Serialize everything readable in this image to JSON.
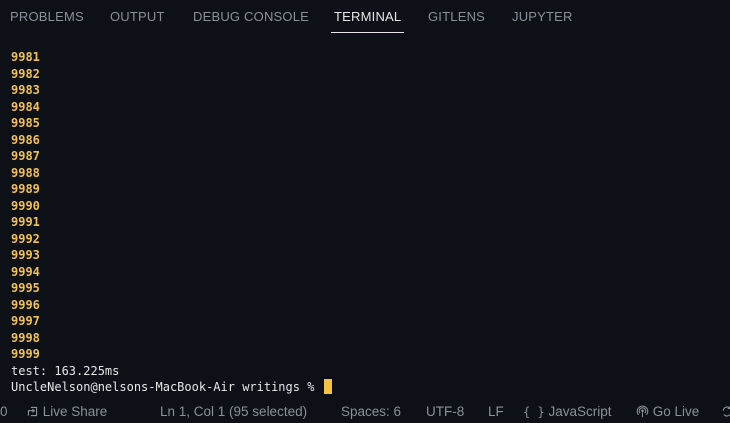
{
  "panel": {
    "tabs": [
      {
        "label": "PROBLEMS"
      },
      {
        "label": "OUTPUT"
      },
      {
        "label": "DEBUG CONSOLE"
      },
      {
        "label": "TERMINAL",
        "active": true
      },
      {
        "label": "GITLENS"
      },
      {
        "label": "JUPYTER"
      }
    ]
  },
  "terminal": {
    "numbers": [
      "9981",
      "9982",
      "9983",
      "9984",
      "9985",
      "9986",
      "9987",
      "9988",
      "9989",
      "9990",
      "9991",
      "9992",
      "9993",
      "9994",
      "9995",
      "9996",
      "9997",
      "9998",
      "9999"
    ],
    "timing": "test: 163.225ms",
    "prompt": "UncleNelson@nelsons-MacBook-Air writings % "
  },
  "statusbar": {
    "left_partial": "0",
    "live_share": "Live Share",
    "cursor_position": "Ln 1, Col 1 (95 selected)",
    "spaces": "Spaces: 6",
    "encoding": "UTF-8",
    "eol": "LF",
    "language": "JavaScript",
    "go_live": "Go Live"
  },
  "colors": {
    "background": "#0d1017",
    "number_text": "#f2c14e",
    "plain_text": "#e6e6e6",
    "muted_text": "#8a8f98",
    "cursor": "#f5c242"
  },
  "icons": {
    "live_share": "live-share-icon",
    "language": "braces-icon",
    "go_live": "broadcast-icon",
    "sync": "sync-icon"
  }
}
